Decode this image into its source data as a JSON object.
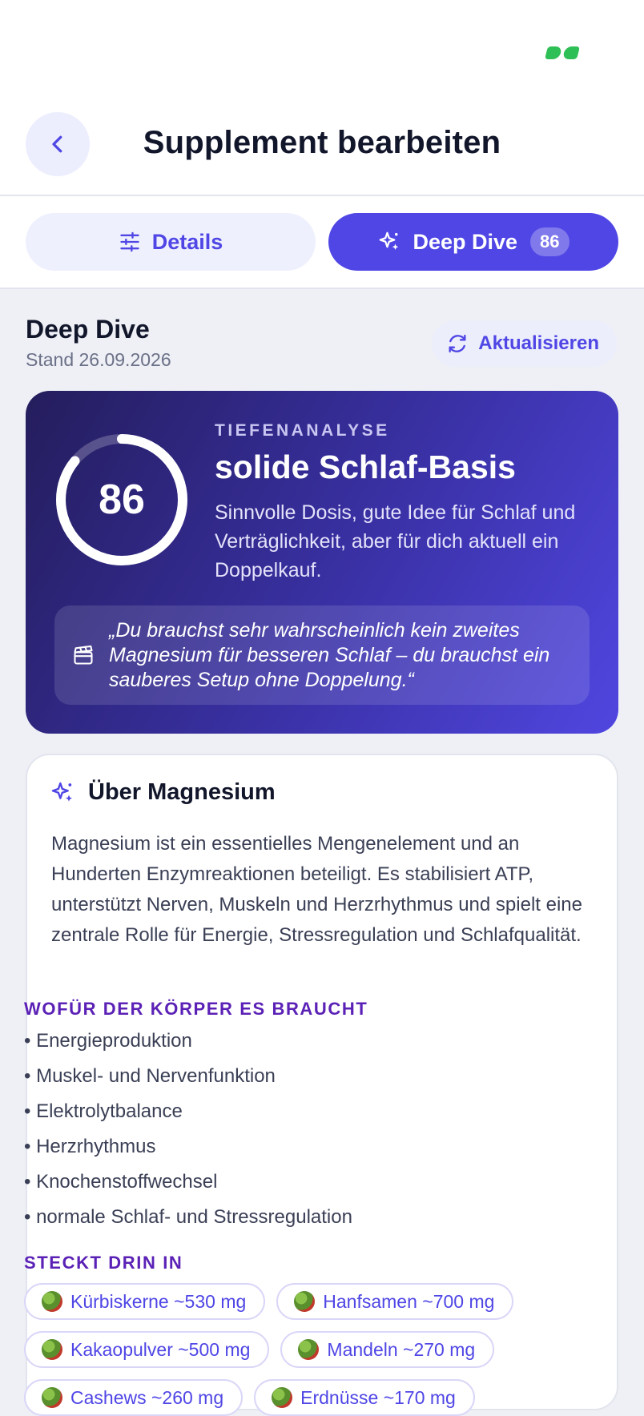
{
  "header": {
    "title": "Supplement bearbeiten"
  },
  "tabs": [
    {
      "label": "Details",
      "icon": "sliders-icon",
      "active": false
    },
    {
      "label": "Deep Dive",
      "icon": "sparkle-icon",
      "active": true,
      "badge": "86"
    }
  ],
  "section": {
    "title": "Deep Dive",
    "subtitle": "Stand 26.09.2026",
    "refresh_label": "Aktualisieren"
  },
  "hero": {
    "score": "86",
    "score_fraction": 0.86,
    "kicker": "TIEFENANALYSE",
    "title": "solide Schlaf-Basis",
    "description": "Sinnvolle Dosis, gute Idee für Schlaf und Verträglichkeit, aber für dich aktuell ein Doppelkauf.",
    "quote": "„Du brauchst sehr wahrscheinlich kein zweites Magnesium für besseren Schlaf – du brauchst ein sauberes Setup ohne Doppelung.“"
  },
  "about": {
    "title": "Über Magnesium",
    "description": "Magnesium ist ein essentielles Mengenelement und an Hunderten Enzymreaktionen beteiligt. Es stabilisiert ATP, unterstützt Nerven, Muskeln und Herzrhythmus und spielt eine zentrale Rolle für Energie, Stressregulation und Schlafqualität.",
    "needs_heading": "WOFÜR DER KÖRPER ES BRAUCHT",
    "needs": [
      "• Energieproduktion",
      "• Muskel- und Nervenfunktion",
      "• Elektrolytbalance",
      "• Herzrhythmus",
      "• Knochenstoffwechsel",
      "• normale Schlaf- und Stressregulation"
    ],
    "sources_heading": "STECKT DRIN IN",
    "sources": [
      "Kürbiskerne ~530 mg",
      "Hanfsamen ~700 mg",
      "Kakaopulver ~500 mg",
      "Mandeln ~270 mg",
      "Cashews ~260 mg",
      "Erdnüsse ~170 mg"
    ]
  },
  "colors": {
    "accent": "#4f46e5",
    "status_green": "#2fbf57",
    "subhead": "#5b21b6"
  }
}
